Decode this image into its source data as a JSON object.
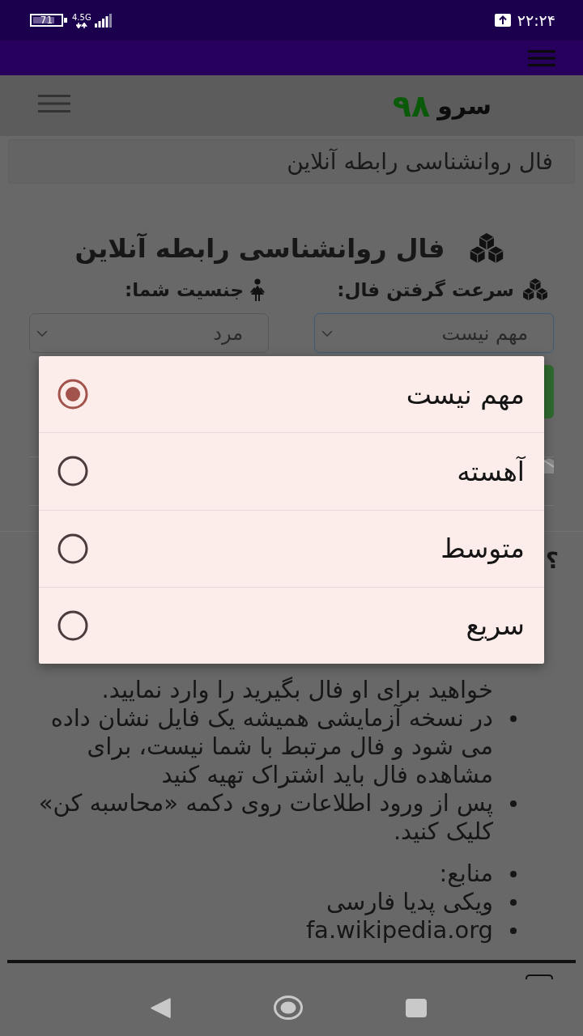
{
  "status_bar": {
    "battery": "71",
    "network": "4.5G",
    "time": "۲۲:۲۴"
  },
  "site_header": {
    "logo_name": "سرو",
    "logo_number": "۹۸"
  },
  "breadcrumb": "فال روانشناسی رابطه آنلاین",
  "page_title": "فال روانشناسی رابطه آنلاین",
  "form": {
    "fields": [
      {
        "label": "سرعت گرفتن فال:",
        "value": "مهم نیست",
        "focused": true
      },
      {
        "label": "جنسیت شما:",
        "value": "مرد",
        "focused": false
      }
    ]
  },
  "section_heading": "؟",
  "speed_dialog": {
    "options": [
      {
        "label": "مهم نیست",
        "selected": true
      },
      {
        "label": "آهسته",
        "selected": false
      },
      {
        "label": "متوسط",
        "selected": false
      },
      {
        "label": "سریع",
        "selected": false
      }
    ]
  },
  "notes": {
    "continuation": "خواهید برای او فال بگیرید را وارد نمایید.",
    "items": [
      "در نسخه آزمایشی همیشه یک فایل نشان داده می شود و فال مرتبط با شما نیست، برای مشاهده فال باید اشتراک تهیه کنید",
      "پس از ورود اطلاعات روی دکمه «محاسبه کن» کلیک کنید."
    ]
  },
  "sources": {
    "items": [
      "منابع:",
      "ویکی پدیا فارسی",
      "fa.wikipedia.org"
    ]
  }
}
